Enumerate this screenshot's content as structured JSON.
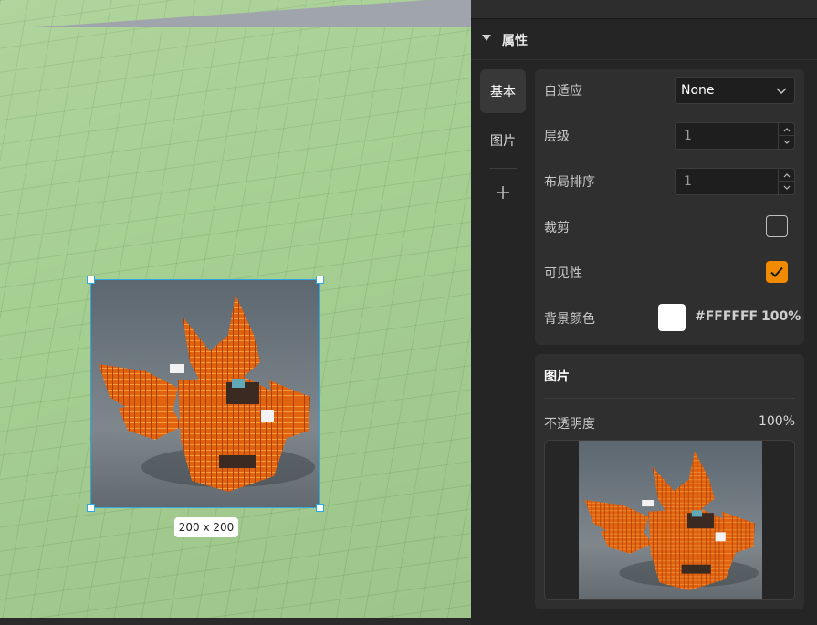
{
  "viewport": {
    "size_label": "200 x 200",
    "ground_color": "#a6cf92",
    "selection_color": "#2fa8e0"
  },
  "panel": {
    "header": {
      "title": "属性",
      "icon": "caret-down-icon"
    },
    "tabs": [
      {
        "label": "基本",
        "active": true
      },
      {
        "label": "图片",
        "active": false
      }
    ],
    "add_tab_icon": "plus-icon",
    "basic": {
      "adaptive": {
        "label": "自适应",
        "value": "None"
      },
      "layer": {
        "label": "层级",
        "value": "1"
      },
      "layout_order": {
        "label": "布局排序",
        "value": "1"
      },
      "clip": {
        "label": "裁剪",
        "checked": false
      },
      "visible": {
        "label": "可见性",
        "checked": true
      },
      "background": {
        "label": "背景颜色",
        "hex": "#FFFFFF",
        "alpha": "100%"
      }
    },
    "image": {
      "title": "图片",
      "opacity_label": "不透明度",
      "opacity_value": "100%"
    },
    "accent_color": "#f08a00"
  }
}
